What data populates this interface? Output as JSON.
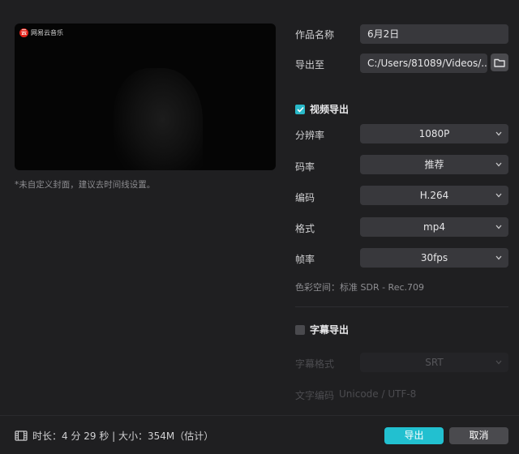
{
  "preview": {
    "watermark_text": "网易云音乐",
    "watermark_logo": "云",
    "hint": "*未自定义封面，建议去时间线设置。"
  },
  "form": {
    "name_label": "作品名称",
    "name_value": "6月2日",
    "export_to_label": "导出至",
    "export_path": "C:/Users/81089/Videos/..."
  },
  "video": {
    "section_title": "视频导出",
    "checked": true,
    "resolution_label": "分辨率",
    "resolution_value": "1080P",
    "bitrate_label": "码率",
    "bitrate_value": "推荐",
    "codec_label": "编码",
    "codec_value": "H.264",
    "format_label": "格式",
    "format_value": "mp4",
    "framerate_label": "帧率",
    "framerate_value": "30fps",
    "color_space": "色彩空间：标准 SDR - Rec.709"
  },
  "subtitle": {
    "section_title": "字幕导出",
    "checked": false,
    "format_label": "字幕格式",
    "format_value": "SRT",
    "encoding_label": "文字编码",
    "encoding_value": "Unicode / UTF-8"
  },
  "footer": {
    "info": "时长：4 分 29 秒 | 大小：354M（估计）",
    "export_button": "导出",
    "cancel_button": "取消"
  },
  "colors": {
    "accent": "#22c0d0",
    "background": "#1f1f21",
    "field": "#38383c"
  }
}
